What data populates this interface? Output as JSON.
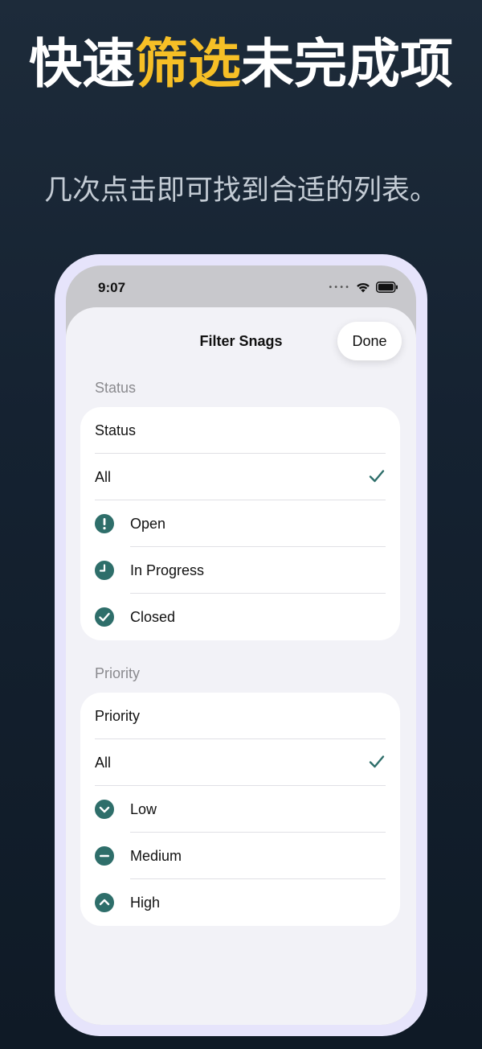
{
  "headline": {
    "part1": "快速",
    "highlight": "筛选",
    "part2": "未完成项"
  },
  "subtitle": "几次点击即可找到合适的列表。",
  "colors": {
    "highlight": "#f6bf26",
    "accent": "#2e6e6a",
    "background": "#15222f"
  },
  "status_bar": {
    "time": "9:07",
    "icons": [
      "signal-dots-icon",
      "wifi-icon",
      "battery-icon"
    ]
  },
  "sheet": {
    "title": "Filter Snags",
    "done_label": "Done"
  },
  "status_section": {
    "header": "Status",
    "picker_label": "Status",
    "options": [
      {
        "label": "All",
        "icon": "",
        "selected": true
      },
      {
        "label": "Open",
        "icon": "exclamation-circle-icon",
        "selected": false
      },
      {
        "label": "In Progress",
        "icon": "clock-circle-icon",
        "selected": false
      },
      {
        "label": "Closed",
        "icon": "checkmark-circle-icon",
        "selected": false
      }
    ]
  },
  "priority_section": {
    "header": "Priority",
    "picker_label": "Priority",
    "options": [
      {
        "label": "All",
        "icon": "",
        "selected": true
      },
      {
        "label": "Low",
        "icon": "chevron-down-circle-icon",
        "selected": false
      },
      {
        "label": "Medium",
        "icon": "minus-circle-icon",
        "selected": false
      },
      {
        "label": "High",
        "icon": "chevron-up-circle-icon",
        "selected": false
      }
    ]
  }
}
